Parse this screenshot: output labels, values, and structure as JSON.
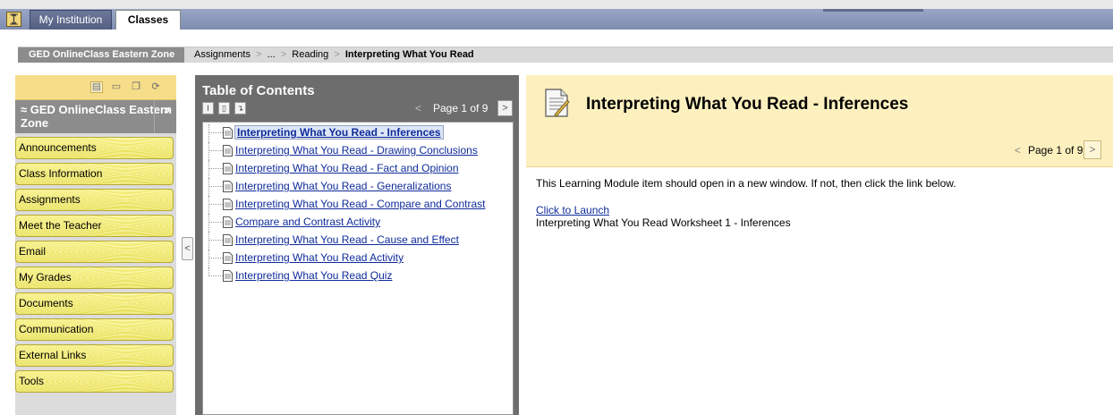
{
  "topbar": {
    "tabs": [
      {
        "label": "My Institution",
        "active": false
      },
      {
        "label": "Classes",
        "active": true
      }
    ]
  },
  "breadcrumb": {
    "course": "GED OnlineClass Eastern Zone",
    "items": [
      "Assignments",
      "...",
      "Reading"
    ],
    "current": "Interpreting What You Read",
    "separator": ">"
  },
  "course_menu": {
    "title": "GED OnlineClass Eastern Zone",
    "collapse_symbol": "»",
    "expand_symbol": "≈",
    "items": [
      "Announcements",
      "Class Information",
      "Assignments",
      "Meet the Teacher",
      "Email",
      "My Grades",
      "Documents",
      "Communication",
      "External Links",
      "Tools"
    ],
    "hide_symbol": "<"
  },
  "toc": {
    "title": "Table of Contents",
    "page_label": "Page 1 of 9",
    "prev_symbol": "<",
    "next_symbol": ">",
    "items": [
      {
        "label": "Interpreting What You Read - Inferences",
        "selected": true
      },
      {
        "label": "Interpreting What You Read - Drawing Conclusions",
        "selected": false
      },
      {
        "label": "Interpreting What You Read - Fact and Opinion",
        "selected": false
      },
      {
        "label": "Interpreting What You Read - Generalizations",
        "selected": false
      },
      {
        "label": "Interpreting What You Read - Compare and Contrast",
        "selected": false
      },
      {
        "label": "Compare and Contrast Activity",
        "selected": false
      },
      {
        "label": "Interpreting What You Read - Cause and Effect",
        "selected": false
      },
      {
        "label": "Interpreting What You Read Activity",
        "selected": false
      },
      {
        "label": "Interpreting What You Read Quiz",
        "selected": false
      }
    ]
  },
  "content": {
    "title": "Interpreting What You Read - Inferences",
    "page_label": "Page 1 of 9",
    "prev_symbol": "<",
    "next_symbol": ">",
    "message": "This Learning Module item should open in a new window. If not, then click the link below.",
    "launch_link": "Click to Launch",
    "item_name": "Interpreting What You Read Worksheet 1 - Inferences"
  },
  "colors": {
    "tab_bar": "#7d8cb0",
    "menu_item": "#fbf58a",
    "toc_panel": "#6d6d6d",
    "content_header": "#fdf0bf",
    "link": "#0f2b9a"
  }
}
